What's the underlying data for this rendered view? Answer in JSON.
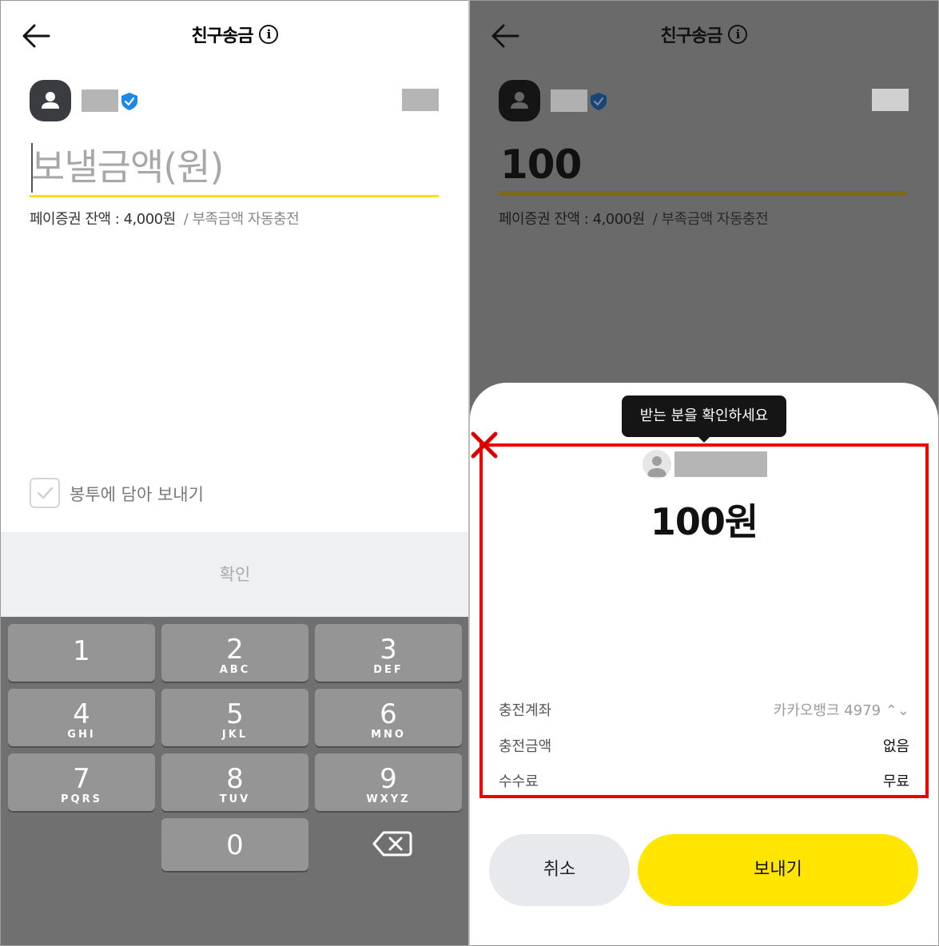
{
  "header": {
    "title": "친구송금",
    "info_icon": "info-icon",
    "back_icon": "back-arrow-icon"
  },
  "left": {
    "amount_placeholder": "보낼금액(원)",
    "balance_text": "페이증권 잔액 : 4,000원",
    "auto_charge_text": "/ 부족금액 자동충전",
    "envelope_label": "봉투에 담아 보내기",
    "confirm_label": "확인",
    "keypad": [
      {
        "num": "1",
        "letters": ""
      },
      {
        "num": "2",
        "letters": "ABC"
      },
      {
        "num": "3",
        "letters": "DEF"
      },
      {
        "num": "4",
        "letters": "GHI"
      },
      {
        "num": "5",
        "letters": "JKL"
      },
      {
        "num": "6",
        "letters": "MNO"
      },
      {
        "num": "7",
        "letters": "PQRS"
      },
      {
        "num": "8",
        "letters": "TUV"
      },
      {
        "num": "9",
        "letters": "WXYZ"
      },
      {
        "num": "0",
        "letters": ""
      }
    ]
  },
  "right": {
    "amount_value": "100",
    "balance_text": "페이증권 잔액 : 4,000원",
    "auto_charge_text": "/ 부족금액 자동충전",
    "tooltip": "받는 분을 확인하세요",
    "amount_big": "100원",
    "rows": [
      {
        "label": "충전계좌",
        "value": "카카오뱅크 4979 ⌃⌄"
      },
      {
        "label": "충전금액",
        "value": "없음"
      },
      {
        "label": "수수료",
        "value": "무료"
      }
    ],
    "cancel_label": "취소",
    "send_label": "보내기"
  },
  "colors": {
    "accent_yellow": "#ffe500",
    "highlight_red": "#ee0000",
    "verified_blue": "#1e88e5"
  }
}
